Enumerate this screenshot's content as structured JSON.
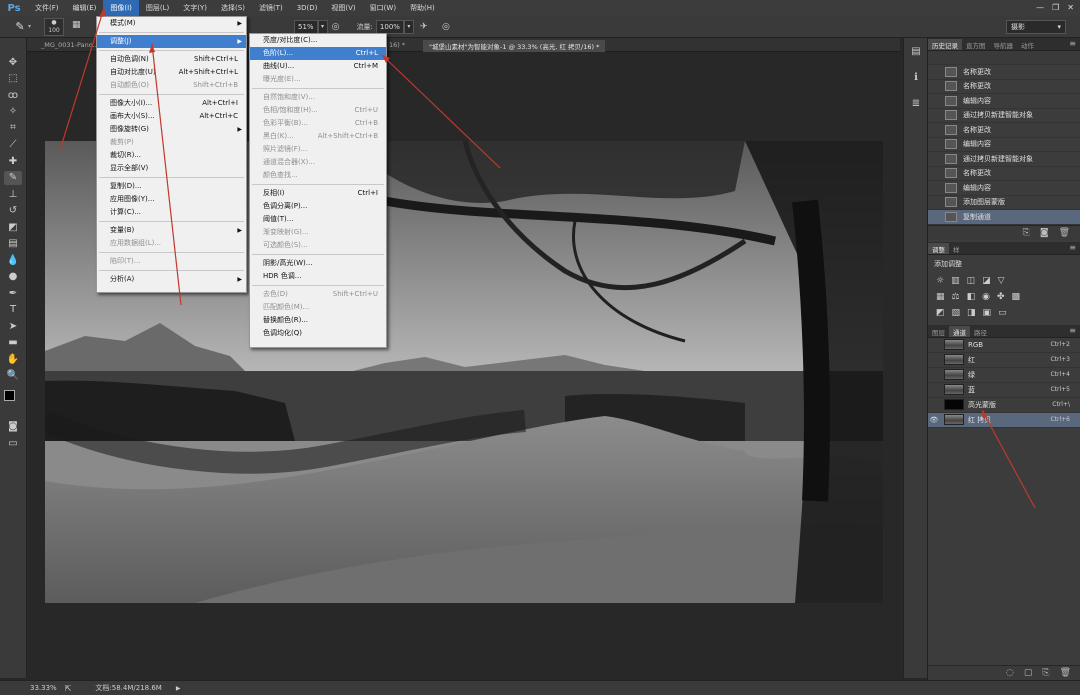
{
  "app": {
    "logo": "Ps"
  },
  "menubar": {
    "items": [
      "文件(F)",
      "编辑(E)",
      "图像(I)",
      "图层(L)",
      "文字(Y)",
      "选择(S)",
      "滤镜(T)",
      "3D(D)",
      "视图(V)",
      "窗口(W)",
      "帮助(H)"
    ]
  },
  "window": {
    "minimize": "—",
    "restore": "❐",
    "close": "✕"
  },
  "options": {
    "brush_size": "100",
    "opacity_value": "51%",
    "flow_label": "流量:",
    "flow_value": "100%",
    "workspace": "摄影"
  },
  "tabs": {
    "tab1": "_MG_0031-Pano...",
    "tab2": "16) *",
    "tab3": "\"城堡山素材\"为智能对象-1 @ 33.3% (高光, 红 拷贝/16) *"
  },
  "image_menu": {
    "items": [
      {
        "label": "模式(M)",
        "shortcut": "",
        "state": "normal",
        "arrow": "▶"
      },
      {
        "sep": true
      },
      {
        "label": "调整(J)",
        "shortcut": "",
        "state": "hl",
        "arrow": "▶"
      },
      {
        "sep": true
      },
      {
        "label": "自动色调(N)",
        "shortcut": "Shift+Ctrl+L",
        "state": "normal"
      },
      {
        "label": "自动对比度(U)",
        "shortcut": "Alt+Shift+Ctrl+L",
        "state": "normal"
      },
      {
        "label": "自动颜色(O)",
        "shortcut": "Shift+Ctrl+B",
        "state": "dis"
      },
      {
        "sep": true
      },
      {
        "label": "图像大小(I)...",
        "shortcut": "Alt+Ctrl+I",
        "state": "normal"
      },
      {
        "label": "画布大小(S)...",
        "shortcut": "Alt+Ctrl+C",
        "state": "normal"
      },
      {
        "label": "图像旋转(G)",
        "shortcut": "",
        "state": "normal",
        "arrow": "▶"
      },
      {
        "label": "裁剪(P)",
        "shortcut": "",
        "state": "dis"
      },
      {
        "label": "裁切(R)...",
        "shortcut": "",
        "state": "normal"
      },
      {
        "label": "显示全部(V)",
        "shortcut": "",
        "state": "normal"
      },
      {
        "sep": true
      },
      {
        "label": "复制(D)...",
        "shortcut": "",
        "state": "normal"
      },
      {
        "label": "应用图像(Y)...",
        "shortcut": "",
        "state": "normal"
      },
      {
        "label": "计算(C)...",
        "shortcut": "",
        "state": "normal"
      },
      {
        "sep": true
      },
      {
        "label": "变量(B)",
        "shortcut": "",
        "state": "normal",
        "arrow": "▶"
      },
      {
        "label": "应用数据组(L)...",
        "shortcut": "",
        "state": "dis"
      },
      {
        "sep": true
      },
      {
        "label": "陷印(T)...",
        "shortcut": "",
        "state": "dis"
      },
      {
        "sep": true
      },
      {
        "label": "分析(A)",
        "shortcut": "",
        "state": "normal",
        "arrow": "▶"
      }
    ]
  },
  "adjust_menu": {
    "items": [
      {
        "label": "亮度/对比度(C)...",
        "shortcut": "",
        "state": "normal"
      },
      {
        "label": "色阶(L)...",
        "shortcut": "Ctrl+L",
        "state": "hl"
      },
      {
        "label": "曲线(U)...",
        "shortcut": "Ctrl+M",
        "state": "normal"
      },
      {
        "label": "曝光度(E)...",
        "shortcut": "",
        "state": "dis"
      },
      {
        "sep": true
      },
      {
        "label": "自然饱和度(V)...",
        "shortcut": "",
        "state": "dis"
      },
      {
        "label": "色相/饱和度(H)...",
        "shortcut": "Ctrl+U",
        "state": "dis"
      },
      {
        "label": "色彩平衡(B)...",
        "shortcut": "Ctrl+B",
        "state": "dis"
      },
      {
        "label": "黑白(K)...",
        "shortcut": "Alt+Shift+Ctrl+B",
        "state": "dis"
      },
      {
        "label": "照片滤镜(F)...",
        "shortcut": "",
        "state": "dis"
      },
      {
        "label": "通道混合器(X)...",
        "shortcut": "",
        "state": "dis"
      },
      {
        "label": "颜色查找...",
        "shortcut": "",
        "state": "dis"
      },
      {
        "sep": true
      },
      {
        "label": "反相(I)",
        "shortcut": "Ctrl+I",
        "state": "normal"
      },
      {
        "label": "色调分离(P)...",
        "shortcut": "",
        "state": "normal"
      },
      {
        "label": "阈值(T)...",
        "shortcut": "",
        "state": "normal"
      },
      {
        "label": "渐变映射(G)...",
        "shortcut": "",
        "state": "dis"
      },
      {
        "label": "可选颜色(S)...",
        "shortcut": "",
        "state": "dis"
      },
      {
        "sep": true
      },
      {
        "label": "阴影/高光(W)...",
        "shortcut": "",
        "state": "normal"
      },
      {
        "label": "HDR 色调...",
        "shortcut": "",
        "state": "normal"
      },
      {
        "sep": true
      },
      {
        "label": "去色(D)",
        "shortcut": "Shift+Ctrl+U",
        "state": "dis"
      },
      {
        "label": "匹配颜色(M)...",
        "shortcut": "",
        "state": "dis"
      },
      {
        "label": "替换颜色(R)...",
        "shortcut": "",
        "state": "normal"
      },
      {
        "label": "色调均化(Q)",
        "shortcut": "",
        "state": "normal"
      }
    ]
  },
  "history_panel": {
    "tabs": [
      "历史记录",
      "直方图",
      "导航器",
      "动作"
    ],
    "items": [
      "名称更改",
      "名称更改",
      "编辑内容",
      "通过拷贝新建智能对象",
      "名称更改",
      "编辑内容",
      "通过拷贝新建智能对象",
      "名称更改",
      "编辑内容",
      "添加图层蒙版",
      "复制通道"
    ]
  },
  "adjustments_panel": {
    "tabs": [
      "调整",
      "样"
    ],
    "title": "添加调整"
  },
  "channels_panel": {
    "tabs": [
      "图层",
      "通道",
      "路径"
    ],
    "items": [
      {
        "name": "RGB",
        "shortcut": "Ctrl+2",
        "thumb": "image",
        "eye": "",
        "sel": false
      },
      {
        "name": "红",
        "shortcut": "Ctrl+3",
        "thumb": "image",
        "eye": "",
        "sel": false
      },
      {
        "name": "绿",
        "shortcut": "Ctrl+4",
        "thumb": "image",
        "eye": "",
        "sel": false
      },
      {
        "name": "蓝",
        "shortcut": "Ctrl+5",
        "thumb": "image",
        "eye": "",
        "sel": false
      },
      {
        "name": "高光蒙版",
        "shortcut": "Ctrl+\\",
        "thumb": "black",
        "eye": "",
        "sel": false
      },
      {
        "name": "红 拷贝",
        "shortcut": "Ctrl+6",
        "thumb": "image",
        "eye": "👁",
        "sel": true
      }
    ]
  },
  "status": {
    "zoom": "33.33%",
    "doc": "文档:58.4M/218.6M"
  },
  "colors": {
    "accent": "#3f7fce",
    "selection": "#59687c",
    "annotation_arrow": "#c0392b"
  }
}
